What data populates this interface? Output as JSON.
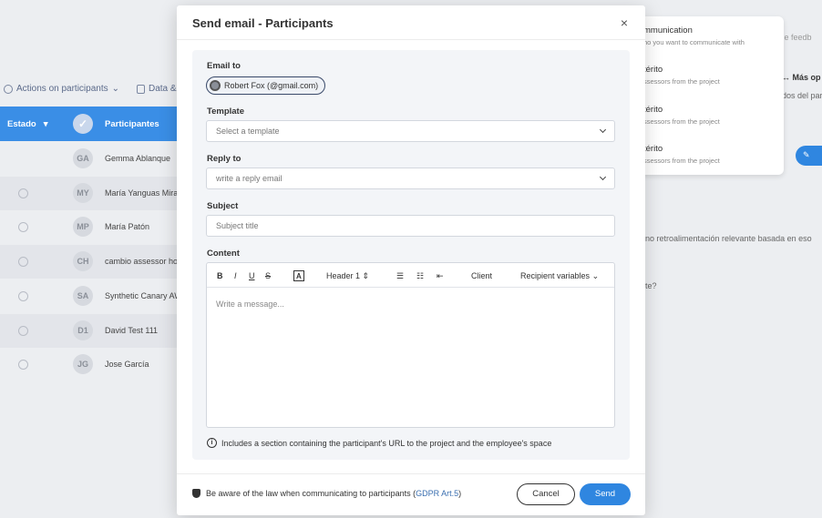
{
  "background": {
    "toolbar": {
      "actions_label": "Actions on participants",
      "data_label": "Data &"
    },
    "table_header": {
      "estado": "Estado",
      "participants": "Participantes"
    },
    "rows": [
      {
        "initials": "GA",
        "name": "Gemma Ablanque"
      },
      {
        "initials": "MY",
        "name": "María Yanguas Mira"
      },
      {
        "initials": "MP",
        "name": "María Patón"
      },
      {
        "initials": "CH",
        "name": "cambio assessor ho"
      },
      {
        "initials": "SA",
        "name": "Synthetic Canary AW"
      },
      {
        "initials": "D1",
        "name": "David Test 111"
      },
      {
        "initials": "JG",
        "name": "Jose García"
      }
    ],
    "dropdown": [
      {
        "title": "mmunication",
        "sub": "ho you want to communicate with"
      },
      {
        "title": "térito",
        "sub": "ssessors from the project"
      },
      {
        "title": "térito",
        "sub": "ssessors from the project"
      },
      {
        "title": "térito",
        "sub": "ssessors from the project"
      }
    ],
    "misc": {
      "feedback": "e de feedb",
      "mas_op": "Más op",
      "dos_del": "dos del par",
      "retro": "no retroalimentación relevante basada en eso",
      "te": "te?"
    }
  },
  "modal": {
    "title": "Send email - Participants",
    "email_to_label": "Email to",
    "recipient": "Robert Fox (@gmail.com)",
    "template_label": "Template",
    "template_placeholder": "Select a template",
    "reply_to_label": "Reply to",
    "reply_to_placeholder": "write a reply email",
    "subject_label": "Subject",
    "subject_placeholder": "Subject title",
    "content_label": "Content",
    "toolbar": {
      "bold": "B",
      "italic": "I",
      "underline": "U",
      "strike": "S",
      "highlight": "A",
      "header": "Header 1",
      "client": "Client",
      "recipient_vars": "Recipient variables"
    },
    "message_placeholder": "Write a message...",
    "info_text": "Includes a section containing the participant's URL to the project and the employee's space",
    "law_text": "Be aware of the law when communicating to participants (",
    "law_link": "GDPR Art.5",
    "law_close": ")",
    "cancel_label": "Cancel",
    "send_label": "Send"
  }
}
